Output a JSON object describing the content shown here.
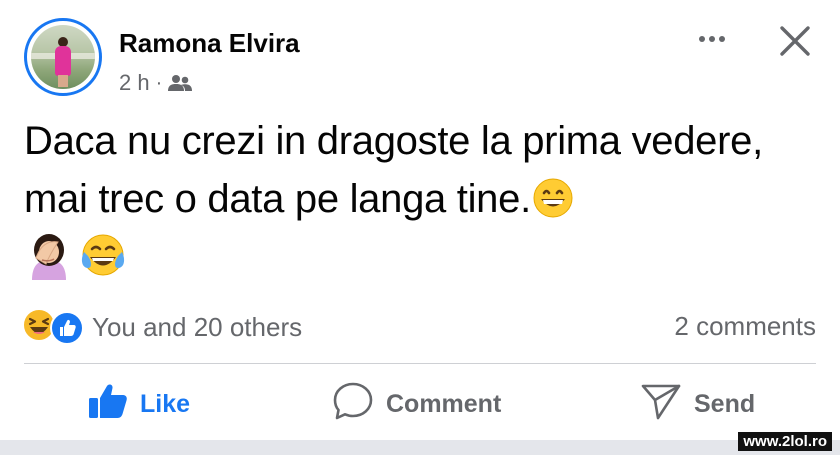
{
  "post": {
    "author": "Ramona Elvira",
    "timestamp": "2 h",
    "separator": "·",
    "audience_icon": "friends-icon",
    "text": "Daca nu crezi in dragoste la prima vedere, mai trec o data pe langa tine.",
    "text_emojis": [
      "grinning-face-emoji"
    ],
    "extra_emojis": [
      "woman-facepalming-emoji",
      "tears-of-joy-emoji"
    ]
  },
  "reactions": {
    "icons": [
      "laughing-reaction-icon",
      "like-reaction-icon"
    ],
    "summary": "You and 20 others",
    "comments": "2 comments"
  },
  "actions": {
    "like": "Like",
    "comment": "Comment",
    "send": "Send"
  },
  "colors": {
    "accent": "#1877f2",
    "secondary_text": "#65676b",
    "divider": "#ced0d4"
  },
  "watermark": "www.2lol.ro"
}
